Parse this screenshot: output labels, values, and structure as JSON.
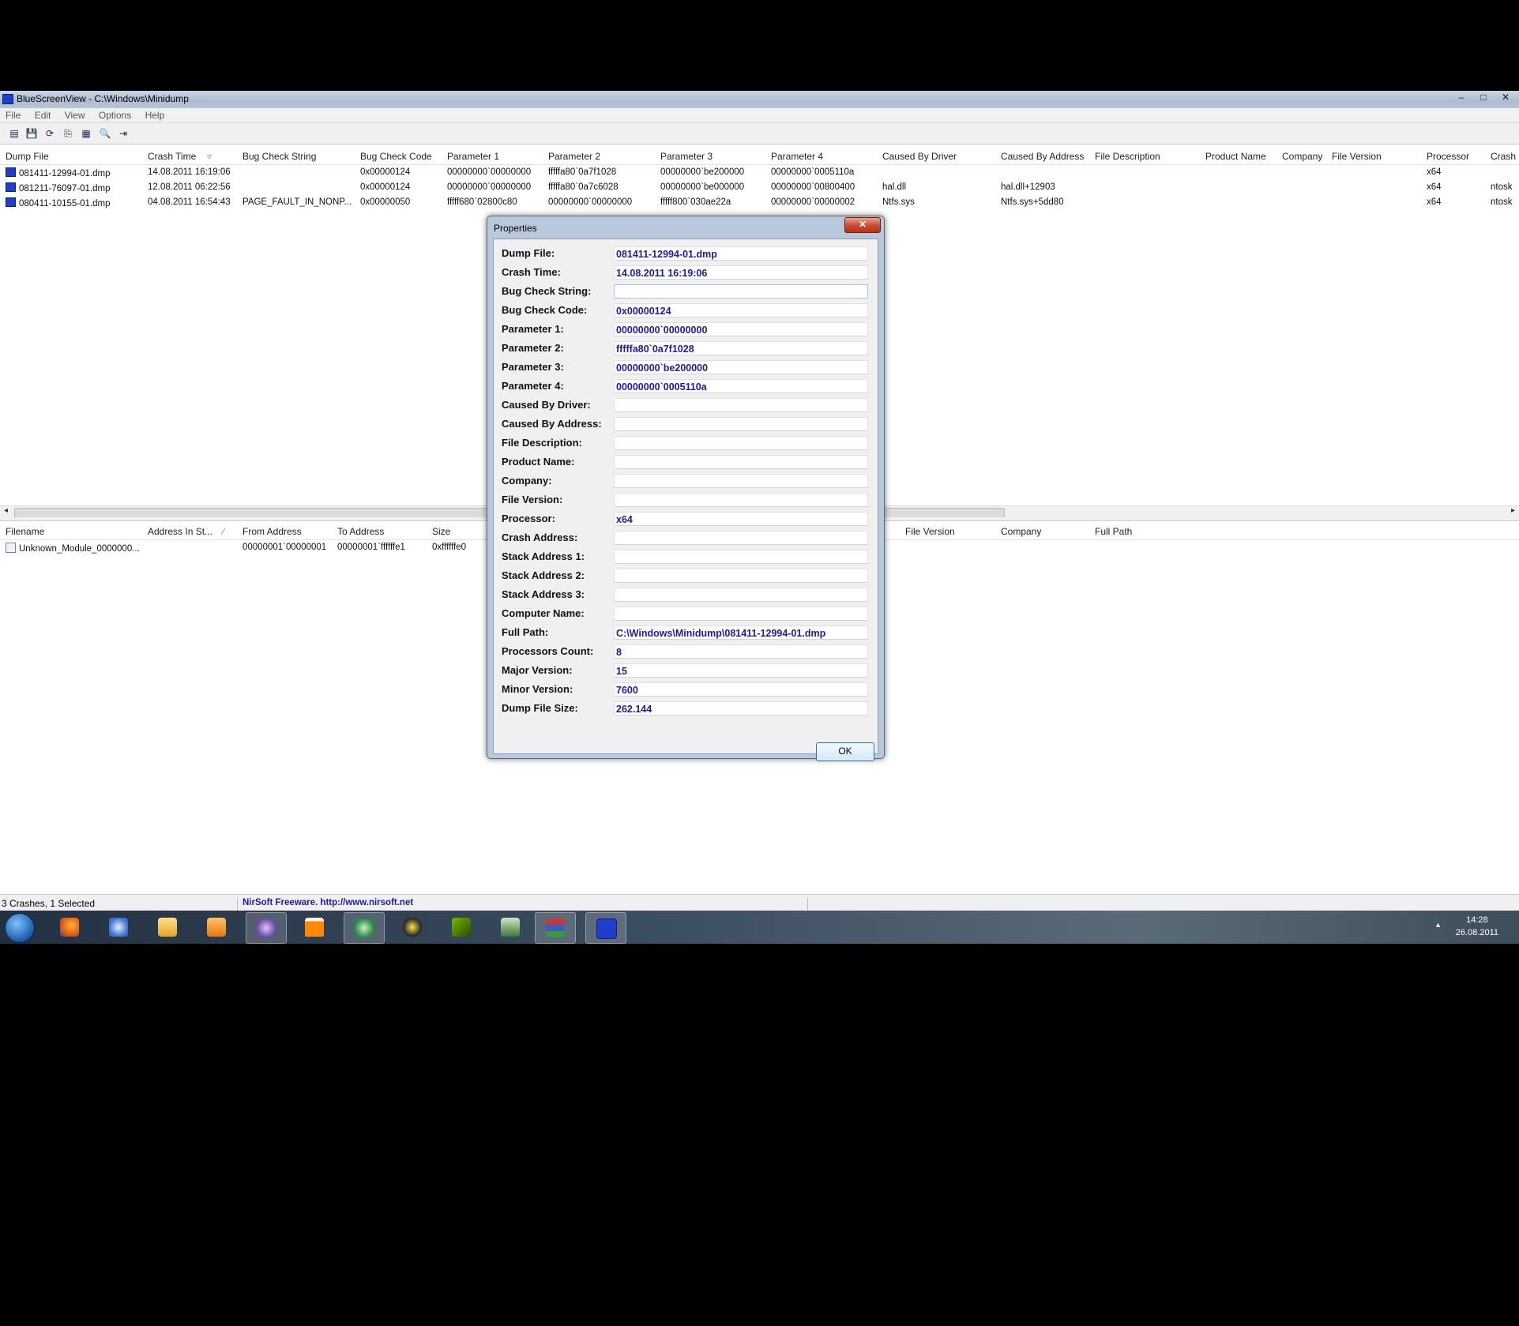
{
  "window": {
    "title": "BlueScreenView  -  C:\\Windows\\Minidump",
    "buttons": {
      "minimize": "–",
      "maximize": "□",
      "close": "✕"
    }
  },
  "menu": [
    "File",
    "Edit",
    "View",
    "Options",
    "Help"
  ],
  "toolbar_icons": [
    "properties-icon",
    "save-icon",
    "refresh-icon",
    "copy-icon",
    "html-report-icon",
    "find-icon",
    "exit-icon"
  ],
  "toolbar_glyphs": [
    "▤",
    "💾",
    "⟳",
    "⎘",
    "▦",
    "🔍",
    "⇥"
  ],
  "crash_columns": [
    "Dump File",
    "Crash Time",
    "Bug Check String",
    "Bug Check Code",
    "Parameter 1",
    "Parameter 2",
    "Parameter 3",
    "Parameter 4",
    "Caused By Driver",
    "Caused By Address",
    "File Description",
    "Product Name",
    "Company",
    "File Version",
    "Processor",
    "Crash"
  ],
  "crash_rows": [
    {
      "dump_file": "081411-12994-01.dmp",
      "crash_time": "14.08.2011 16:19:06",
      "bug_check_string": "",
      "bug_check_code": "0x00000124",
      "p1": "00000000`00000000",
      "p2": "fffffa80`0a7f1028",
      "p3": "00000000`be200000",
      "p4": "00000000`0005110a",
      "driver": "",
      "address": "",
      "processor": "x64",
      "crash": ""
    },
    {
      "dump_file": "081211-76097-01.dmp",
      "crash_time": "12.08.2011 06:22:56",
      "bug_check_string": "",
      "bug_check_code": "0x00000124",
      "p1": "00000000`00000000",
      "p2": "fffffa80`0a7c6028",
      "p3": "00000000`be000000",
      "p4": "00000000`00800400",
      "driver": "hal.dll",
      "address": "hal.dll+12903",
      "processor": "x64",
      "crash": "ntosk"
    },
    {
      "dump_file": "080411-10155-01.dmp",
      "crash_time": "04.08.2011 16:54:43",
      "bug_check_string": "PAGE_FAULT_IN_NONP...",
      "bug_check_code": "0x00000050",
      "p1": "fffff680`02800c80",
      "p2": "00000000`00000000",
      "p3": "fffff800`030ae22a",
      "p4": "00000000`00000002",
      "driver": "Ntfs.sys",
      "address": "Ntfs.sys+5dd80",
      "processor": "x64",
      "crash": "ntosk"
    }
  ],
  "module_columns": [
    "Filename",
    "Address In St...",
    "From Address",
    "To Address",
    "Size",
    "File Version",
    "Company",
    "Full Path"
  ],
  "module_rows": [
    {
      "filename": "Unknown_Module_0000000...",
      "address_in_stack": "",
      "from": "00000001`00000001",
      "to": "00000001`ffffffe1",
      "size": "0xffffffe0"
    }
  ],
  "status": {
    "left": "3 Crashes, 1 Selected",
    "middle": "NirSoft Freeware.  http://www.nirsoft.net"
  },
  "taskbar": {
    "icons": [
      "firefox-icon",
      "thunderbird-icon",
      "explorer-icon",
      "media-player-icon",
      "pidgin-icon",
      "vlc-icon",
      "network-icon",
      "xmarks-icon",
      "nvidia-icon",
      "task-manager-icon",
      "winrar-icon",
      "bluescreenview-icon"
    ],
    "time": "14:28",
    "date": "26.08.2011"
  },
  "dialog": {
    "title": "Properties",
    "close": "✕",
    "ok": "OK",
    "fields": [
      {
        "label": "Dump File:",
        "value": "081411-12994-01.dmp"
      },
      {
        "label": "Crash Time:",
        "value": "14.08.2011 16:19:06"
      },
      {
        "label": "Bug Check String:",
        "value": ""
      },
      {
        "label": "Bug Check Code:",
        "value": "0x00000124"
      },
      {
        "label": "Parameter 1:",
        "value": "00000000`00000000"
      },
      {
        "label": "Parameter 2:",
        "value": "fffffa80`0a7f1028"
      },
      {
        "label": "Parameter 3:",
        "value": "00000000`be200000"
      },
      {
        "label": "Parameter 4:",
        "value": "00000000`0005110a"
      },
      {
        "label": "Caused By Driver:",
        "value": ""
      },
      {
        "label": "Caused By Address:",
        "value": ""
      },
      {
        "label": "File Description:",
        "value": ""
      },
      {
        "label": "Product Name:",
        "value": ""
      },
      {
        "label": "Company:",
        "value": ""
      },
      {
        "label": "File Version:",
        "value": ""
      },
      {
        "label": "Processor:",
        "value": "x64"
      },
      {
        "label": "Crash Address:",
        "value": ""
      },
      {
        "label": "Stack Address 1:",
        "value": ""
      },
      {
        "label": "Stack Address 2:",
        "value": ""
      },
      {
        "label": "Stack Address 3:",
        "value": ""
      },
      {
        "label": "Computer Name:",
        "value": ""
      },
      {
        "label": "Full Path:",
        "value": "C:\\Windows\\Minidump\\081411-12994-01.dmp"
      },
      {
        "label": "Processors Count:",
        "value": "8"
      },
      {
        "label": "Major Version:",
        "value": "15"
      },
      {
        "label": "Minor Version:",
        "value": "7600"
      },
      {
        "label": "Dump File Size:",
        "value": "262.144"
      }
    ]
  }
}
